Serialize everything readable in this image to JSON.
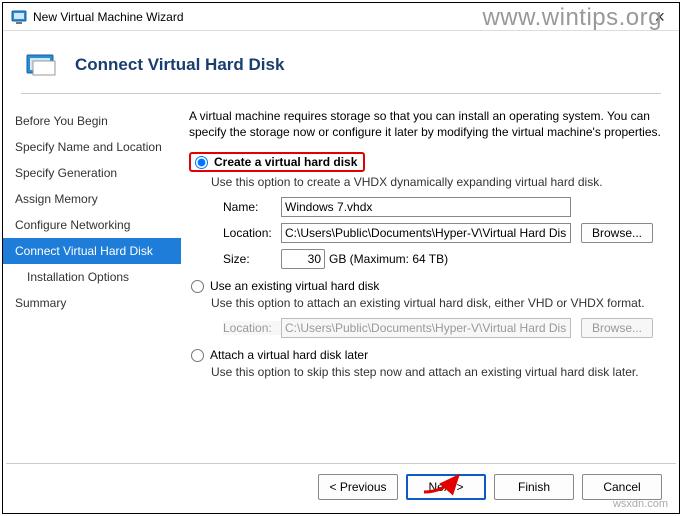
{
  "window": {
    "title": "New Virtual Machine Wizard"
  },
  "header": {
    "title": "Connect Virtual Hard Disk"
  },
  "sidebar": {
    "items": [
      {
        "label": "Before You Begin"
      },
      {
        "label": "Specify Name and Location"
      },
      {
        "label": "Specify Generation"
      },
      {
        "label": "Assign Memory"
      },
      {
        "label": "Configure Networking"
      },
      {
        "label": "Connect Virtual Hard Disk",
        "active": true
      },
      {
        "label": "Installation Options",
        "indent": true
      },
      {
        "label": "Summary"
      }
    ]
  },
  "content": {
    "intro": "A virtual machine requires storage so that you can install an operating system. You can specify the storage now or configure it later by modifying the virtual machine's properties.",
    "option_create": {
      "label": "Create a virtual hard disk",
      "desc": "Use this option to create a VHDX dynamically expanding virtual hard disk.",
      "fields": {
        "name_label": "Name:",
        "name_value": "Windows 7.vhdx",
        "location_label": "Location:",
        "location_value": "C:\\Users\\Public\\Documents\\Hyper-V\\Virtual Hard Disks\\",
        "browse": "Browse...",
        "size_label": "Size:",
        "size_value": "30",
        "size_unit": "GB (Maximum: 64 TB)"
      }
    },
    "option_existing": {
      "label": "Use an existing virtual hard disk",
      "desc": "Use this option to attach an existing virtual hard disk, either VHD or VHDX format.",
      "fields": {
        "location_label": "Location:",
        "location_value": "C:\\Users\\Public\\Documents\\Hyper-V\\Virtual Hard Disks\\",
        "browse": "Browse..."
      }
    },
    "option_later": {
      "label": "Attach a virtual hard disk later",
      "desc": "Use this option to skip this step now and attach an existing virtual hard disk later."
    }
  },
  "footer": {
    "previous": "< Previous",
    "next": "Next >",
    "finish": "Finish",
    "cancel": "Cancel"
  },
  "watermarks": {
    "top": "www.wintips.org",
    "bottom": "wsxdn.com"
  }
}
